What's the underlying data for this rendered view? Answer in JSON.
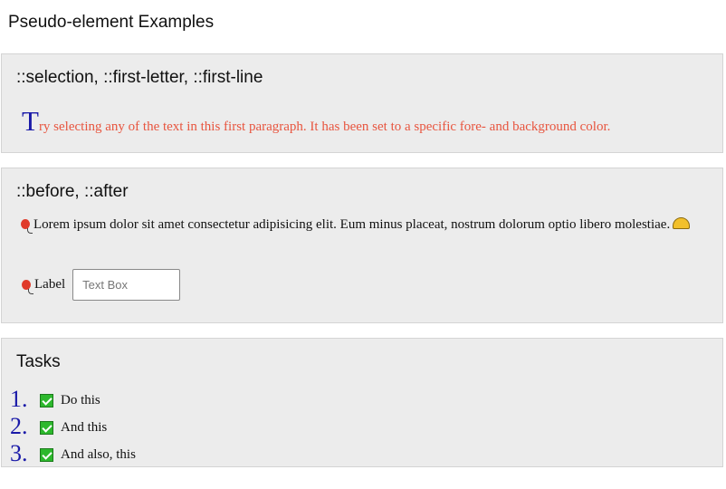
{
  "page_title": "Pseudo-element Examples",
  "sections": {
    "selection": {
      "heading": "::selection, ::first-letter, ::first-line",
      "first_letter": "T",
      "paragraph_rest": "ry selecting any of the text in this first paragraph. It has been set to a specific fore- and background color.",
      "first_letter_color": "#1a1aa8",
      "text_color": "#e8553f"
    },
    "before_after": {
      "heading": "::before, ::after",
      "paragraph": "Lorem ipsum dolor sit amet consectetur adipisicing elit. Eum minus placeat, nostrum dolorum optio libero molestiae.",
      "before_icon": "balloon-icon",
      "after_icon": "taco-icon",
      "label": "Label",
      "text_box_placeholder": "Text Box"
    },
    "tasks": {
      "heading": "Tasks",
      "items": [
        {
          "number": "1.",
          "text": "Do this",
          "checked": true
        },
        {
          "number": "2.",
          "text": "And this",
          "checked": true
        },
        {
          "number": "3.",
          "text": "And also, this",
          "checked": true
        }
      ],
      "number_color": "#1a1aa8",
      "check_color": "#2db82d"
    }
  }
}
